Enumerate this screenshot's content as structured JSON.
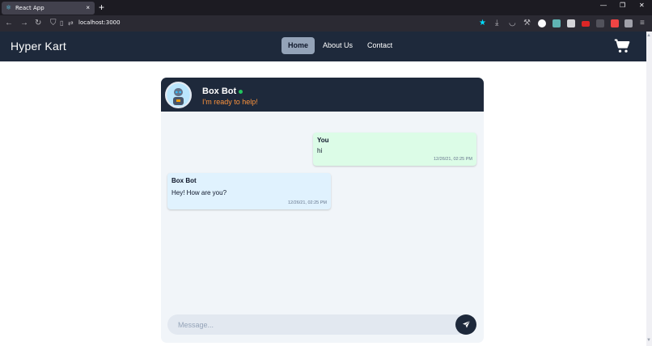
{
  "browser": {
    "tab_title": "React App",
    "tab_close": "×",
    "new_tab": "+",
    "url": "localhost:3000",
    "window_minimize": "—",
    "window_restore": "❐",
    "window_close": "✕"
  },
  "app": {
    "brand": "Hyper Kart",
    "nav": [
      "Home",
      "About Us",
      "Contact"
    ],
    "active_nav": "Home",
    "cart_icon": "shopping-cart-icon"
  },
  "chat": {
    "bot_name": "Box Bot",
    "bot_status": "I'm ready to help!",
    "messages": [
      {
        "sender": "You",
        "text": "hi",
        "time": "12/26/21, 02:25 PM",
        "kind": "user"
      },
      {
        "sender": "Box Bot",
        "text": "Hey! How are you?",
        "time": "12/26/21, 02:25 PM",
        "kind": "bot"
      }
    ],
    "input_placeholder": "Message...",
    "send_icon": "paper-plane-icon"
  },
  "colors": {
    "header_bg": "#1e293b",
    "active_nav_bg": "#94a3b8",
    "status_color": "#fb923c",
    "online_dot": "#22c55e",
    "user_bubble": "#dcfce7",
    "bot_bubble": "#e0f2fe"
  }
}
